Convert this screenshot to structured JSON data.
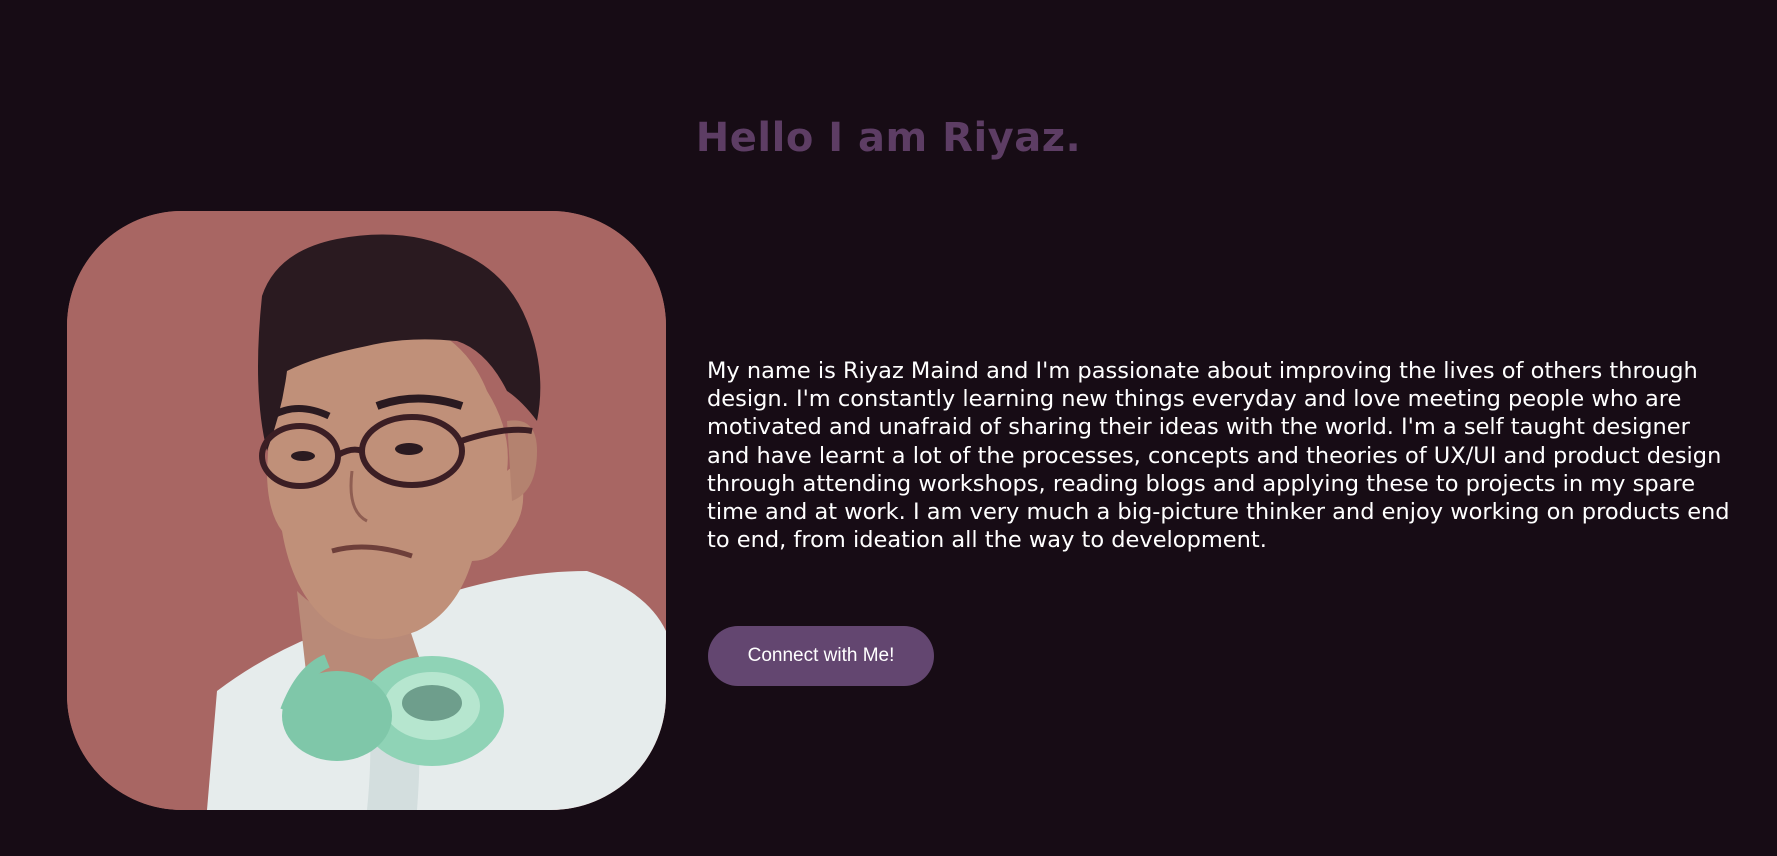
{
  "hero": {
    "title": "Hello I am Riyaz.",
    "bio": "My name is Riyaz Maind and I'm passionate about improving the lives of others through design. I'm constantly learning new things everyday and love meeting people who are motivated and unafraid of sharing their ideas with the world. I'm a self taught designer and have learnt a lot of the processes, concepts and theories of UX/UI and product design through attending workshops, reading blogs and applying these to projects in my spare time and at work. I am very much a big-picture thinker and enjoy working on products end to end, from ideation all the way to development.",
    "cta_label": "Connect with Me!"
  },
  "colors": {
    "background": "#170c15",
    "title": "#5d3d64",
    "button": "#634670",
    "photo_background": "#a86663"
  }
}
